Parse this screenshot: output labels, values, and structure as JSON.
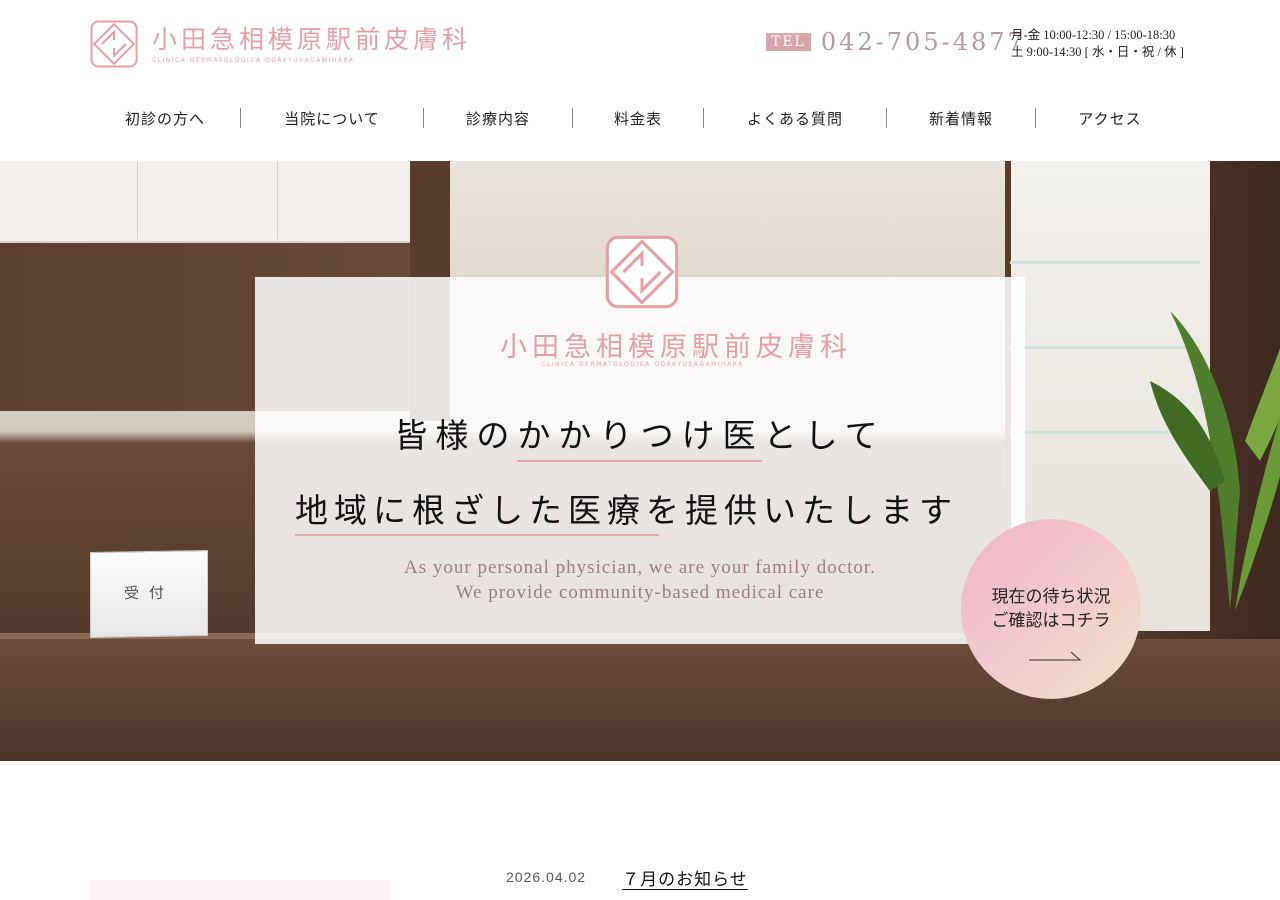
{
  "header": {
    "logo_ja": "小田急相模原駅前皮膚科",
    "logo_en": "CLINICA DERMATOLOGICA ODAKYUSAGAMIHARA",
    "tel_label": "TEL",
    "tel_number": "042-705-4877",
    "hours_line1": "月-金 10:00-12:30 / 15:00-18:30",
    "hours_line2": "土 9:00-14:30 [ 水・日・祝 / 休 ]"
  },
  "nav": {
    "items": [
      {
        "label": "初診の方へ"
      },
      {
        "label": "当院について"
      },
      {
        "label": "診療内容"
      },
      {
        "label": "料金表"
      },
      {
        "label": "よくある質問"
      },
      {
        "label": "新着情報"
      },
      {
        "label": "アクセス"
      }
    ]
  },
  "hero": {
    "sign_text": "受付",
    "card_logo_ja": "小田急相模原駅前皮膚科",
    "card_logo_en": "CLINICA DERMATOLOGICA ODAKYUSAGAMIHARA",
    "headline1": "皆様のかかりつけ医として",
    "headline2": "地域に根ざした医療を提供いたします",
    "sub_en_line1": "As your personal physician, we are your family doctor.",
    "sub_en_line2": "We provide community-based medical care"
  },
  "wait_status": {
    "line1": "現在の待ち状況",
    "line2": "ご確認はコチラ"
  },
  "news": {
    "date": "2026.04.02",
    "title": "７月のお知らせ"
  },
  "colors": {
    "brand_pink": "#e5a0a6",
    "tel_label_bg": "#d8a5ac",
    "underline_pink": "#e3a9ae",
    "circle_gradient_start": "#eeb6c8",
    "circle_gradient_end": "#f2e1c6"
  },
  "icons": [
    "logo-mark-icon",
    "arrow-right-icon"
  ]
}
